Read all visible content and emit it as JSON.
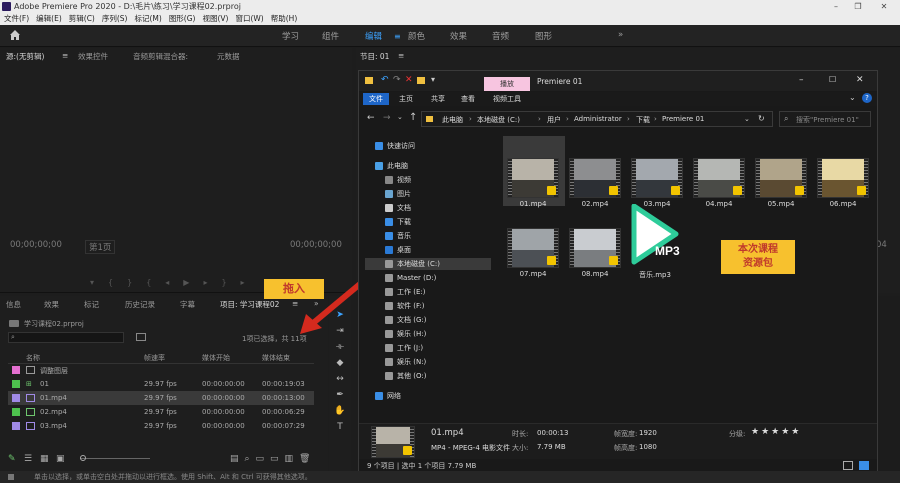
{
  "titlebar": {
    "title": "Adobe Premiere Pro 2020 - D:\\毛片\\练习\\学习课程02.prproj"
  },
  "menu": [
    "文件(F)",
    "编辑(E)",
    "剪辑(C)",
    "序列(S)",
    "标记(M)",
    "图形(G)",
    "视图(V)",
    "窗口(W)",
    "帮助(H)"
  ],
  "workspaces": [
    "学习",
    "组件",
    "编辑",
    "颜色",
    "效果",
    "音频",
    "图形"
  ],
  "workspace_active": "编辑",
  "source_panel": {
    "tabs": [
      "源:(无剪辑)",
      "效果控件",
      "音频剪辑混合器:",
      "元数据"
    ],
    "tc_left": "00;00;00;00",
    "tc_mid": "第1页",
    "tc_right": "00;00;00;00"
  },
  "program_panel": {
    "title": "节目: 01",
    "tc_right": "04"
  },
  "project_panel": {
    "tabs": [
      "信息",
      "效果",
      "标记",
      "历史记录",
      "字幕",
      "项目: 学习课程02"
    ],
    "file": "学习课程02.prproj",
    "count": "1项已选择，共 11项",
    "headers": [
      "名称",
      "帧速率",
      "媒体开始",
      "媒体结束"
    ],
    "rows": [
      {
        "name": "调整图层",
        "fps": "",
        "start": "",
        "end": "",
        "color": "#e46fd0"
      },
      {
        "name": "01",
        "fps": "29.97 fps",
        "start": "00:00:00:00",
        "end": "00:00:19:03",
        "color": "#4ec24e"
      },
      {
        "name": "01.mp4",
        "fps": "29.97 fps",
        "start": "00:00:00:00",
        "end": "00:00:13:00",
        "color": "#a08ae6"
      },
      {
        "name": "02.mp4",
        "fps": "29.97 fps",
        "start": "00:00:00:00",
        "end": "00:00:06:29",
        "color": "#4ec24e"
      },
      {
        "name": "03.mp4",
        "fps": "29.97 fps",
        "start": "00:00:00:00",
        "end": "00:00:07:29",
        "color": "#a08ae6"
      }
    ]
  },
  "callout_drag": "拖入",
  "callout_resource": "本次课程\n资源包",
  "explorer": {
    "context_tab": "播放",
    "title": "Premiere 01",
    "ribbon": [
      "文件",
      "主页",
      "共享",
      "查看",
      "视频工具"
    ],
    "address": [
      "此电脑",
      "本地磁盘 (C:)",
      "用户",
      "Administrator",
      "下载",
      "Premiere 01"
    ],
    "search_placeholder": "搜索\"Premiere 01\"",
    "nav": [
      "快速访问",
      "此电脑",
      "视频",
      "图片",
      "文档",
      "下载",
      "音乐",
      "桌面",
      "本地磁盘 (C:)",
      "Master (D:)",
      "工作 (E:)",
      "软件 (F:)",
      "文档 (G:)",
      "娱乐 (H:)",
      "工作 (J:)",
      "娱乐 (N:)",
      "其他 (O:)",
      "网络"
    ],
    "files": [
      "01.mp4",
      "02.mp4",
      "03.mp4",
      "04.mp4",
      "05.mp4",
      "06.mp4",
      "07.mp4",
      "08.mp4",
      "音乐.mp3"
    ],
    "mp3_label": "MP3",
    "details": {
      "name": "01.mp4",
      "type": "MP4 - MPEG-4 电影文件",
      "duration_label": "时长:",
      "duration": "00:00:13",
      "size_label": "大小:",
      "size": "7.79 MB",
      "width_label": "帧宽度:",
      "width": "1920",
      "height_label": "帧高度:",
      "height": "1080",
      "rating_label": "分级:",
      "rating": "★★★★★"
    },
    "status": "9 个项目  |  选中 1 个项目  7.79 MB"
  },
  "statusbar": "单击以选择，或单击空白处并拖动以进行框选。使用 Shift、Alt 和 Ctrl 可获得其他选项。"
}
